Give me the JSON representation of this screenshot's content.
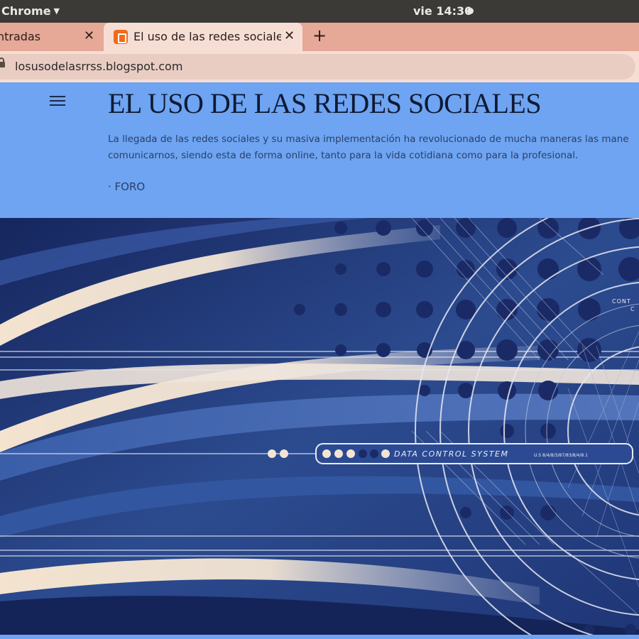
{
  "os": {
    "app_name": "Chrome",
    "clock": "vie 14:30"
  },
  "browser": {
    "tabs": [
      {
        "title": "ntradas"
      },
      {
        "title": "El uso de las redes sociales"
      }
    ],
    "url": "losusodelasrrss.blogspot.com"
  },
  "blog": {
    "title": "EL USO DE LAS REDES SOCIALES",
    "description_line1": "La llegada de las redes sociales y su masiva implementación ha revolucionado de mucha maneras las mane",
    "description_line2": "comunicarnos, siendo esta de forma online, tanto para la vida cotidiana como para la profesional.",
    "nav_link": "· FORO"
  },
  "hero": {
    "panel_text": "DATA CONTROL SYSTEM",
    "panel_subtext": "U.S 8/4/8/3/87/83/8/4/8.1",
    "corner_text_1": "CONT",
    "corner_text_2": "C"
  },
  "colors": {
    "os_bar": "#3b3a36",
    "tab_strip": "#e6a897",
    "active_tab": "#f7ded5",
    "blog_header": "#6ea4f1",
    "hero_navy": "#1d2f6a"
  }
}
